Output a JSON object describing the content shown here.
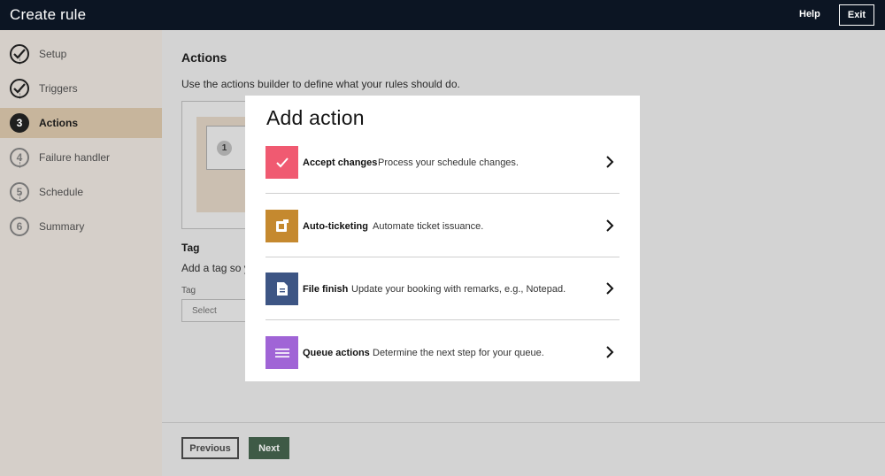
{
  "header": {
    "title": "Create rule",
    "help": "Help",
    "exit": "Exit"
  },
  "sidebar": {
    "steps": [
      {
        "number": "1",
        "label": "Setup",
        "state": "done"
      },
      {
        "number": "2",
        "label": "Triggers",
        "state": "done"
      },
      {
        "number": "3",
        "label": "Actions",
        "state": "current"
      },
      {
        "number": "4",
        "label": "Failure handler",
        "state": "todo"
      },
      {
        "number": "5",
        "label": "Schedule",
        "state": "todo"
      },
      {
        "number": "6",
        "label": "Summary",
        "state": "todo"
      }
    ]
  },
  "main": {
    "heading": "Actions",
    "description": "Use the actions builder to define what your rules should do.",
    "builder_slot_number": "1",
    "tag_heading": "Tag",
    "tag_description": "Add a tag so y",
    "tag_label": "Tag",
    "tag_select_value": "Select",
    "previous": "Previous",
    "next": "Next"
  },
  "modal": {
    "title": "Add action",
    "options": [
      {
        "name": "Accept changes",
        "description": "Process your schedule changes.",
        "icon": "check-icon",
        "color": "#f05a71"
      },
      {
        "name": "Auto-ticketing",
        "description": "Automate ticket issuance.",
        "icon": "ticket-icon",
        "color": "#c5892f"
      },
      {
        "name": "File finish",
        "description": "Update your booking with remarks, e.g., Notepad.",
        "icon": "document-icon",
        "color": "#3d5584"
      },
      {
        "name": "Queue actions",
        "description": "Determine the next step for your queue.",
        "icon": "list-icon",
        "color": "#a064d6"
      }
    ]
  },
  "colors": {
    "header_bg": "#0c1523",
    "active_step_bg": "#c7b59c",
    "next_button_bg": "#3e5a46"
  }
}
